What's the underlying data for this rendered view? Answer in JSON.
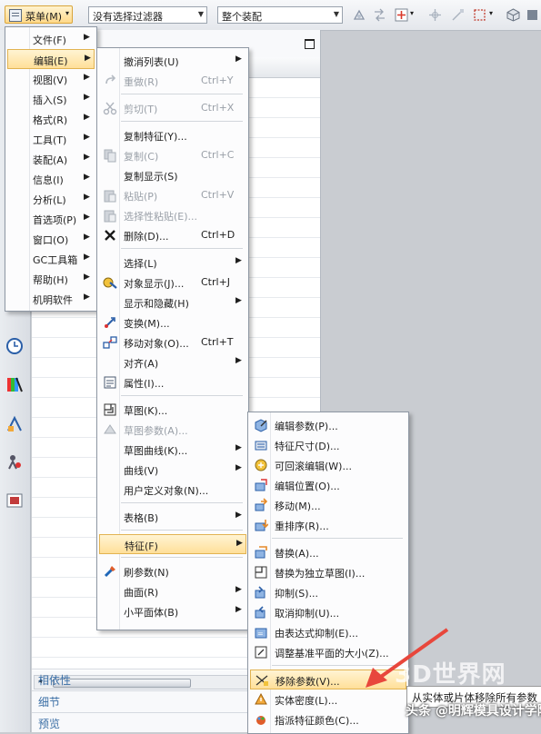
{
  "toolbar": {
    "menu_label": "菜单(M)",
    "filter_value": "没有选择过滤器",
    "scope_value": "整个装配"
  },
  "main_menu": [
    {
      "label": "文件(F)",
      "sub": true
    },
    {
      "label": "编辑(E)",
      "sub": true,
      "active": true
    },
    {
      "label": "视图(V)",
      "sub": true
    },
    {
      "label": "插入(S)",
      "sub": true
    },
    {
      "label": "格式(R)",
      "sub": true
    },
    {
      "label": "工具(T)",
      "sub": true
    },
    {
      "label": "装配(A)",
      "sub": true
    },
    {
      "label": "信息(I)",
      "sub": true
    },
    {
      "label": "分析(L)",
      "sub": true
    },
    {
      "label": "首选项(P)",
      "sub": true
    },
    {
      "label": "窗口(O)",
      "sub": true
    },
    {
      "label": "GC工具箱",
      "sub": true
    },
    {
      "label": "帮助(H)",
      "sub": true
    },
    {
      "label": "机明软件",
      "sub": true
    }
  ],
  "edit_menu": [
    {
      "label": "撤消列表(U)",
      "sub": true,
      "icon": ""
    },
    {
      "label": "重做(R)",
      "shortcut": "Ctrl+Y",
      "disabled": true,
      "icon": "redo-icon"
    },
    {
      "sep": true
    },
    {
      "label": "剪切(T)",
      "shortcut": "Ctrl+X",
      "disabled": true,
      "icon": "scissors-icon"
    },
    {
      "sep": true
    },
    {
      "label": "复制特征(Y)...",
      "icon": ""
    },
    {
      "label": "复制(C)",
      "shortcut": "Ctrl+C",
      "disabled": true,
      "icon": "copy-icon"
    },
    {
      "label": "复制显示(S)",
      "icon": ""
    },
    {
      "label": "粘贴(P)",
      "shortcut": "Ctrl+V",
      "disabled": true,
      "icon": "paste-icon"
    },
    {
      "label": "选择性粘贴(E)...",
      "disabled": true,
      "icon": "paste-special-icon"
    },
    {
      "label": "删除(D)...",
      "shortcut": "Ctrl+D",
      "icon": "delete-icon"
    },
    {
      "sep": true
    },
    {
      "label": "选择(L)",
      "sub": true,
      "icon": ""
    },
    {
      "label": "对象显示(J)...",
      "shortcut": "Ctrl+J",
      "icon": "object-display-icon"
    },
    {
      "label": "显示和隐藏(H)",
      "sub": true,
      "icon": ""
    },
    {
      "label": "变换(M)...",
      "icon": "transform-icon"
    },
    {
      "label": "移动对象(O)...",
      "shortcut": "Ctrl+T",
      "icon": "move-object-icon"
    },
    {
      "label": "对齐(A)",
      "sub": true,
      "icon": ""
    },
    {
      "label": "属性(I)...",
      "icon": "properties-icon"
    },
    {
      "sep": true
    },
    {
      "label": "草图(K)...",
      "icon": "sketch-icon"
    },
    {
      "label": "草图参数(A)...",
      "disabled": true,
      "icon": "sketch-params-icon"
    },
    {
      "label": "草图曲线(K)...",
      "sub": true,
      "icon": ""
    },
    {
      "label": "曲线(V)",
      "sub": true,
      "icon": ""
    },
    {
      "label": "用户定义对象(N)...",
      "icon": ""
    },
    {
      "sep": true
    },
    {
      "label": "表格(B)",
      "sub": true,
      "icon": ""
    },
    {
      "sep": true
    },
    {
      "label": "特征(F)",
      "sub": true,
      "highlight": true,
      "icon": ""
    },
    {
      "sep": true
    },
    {
      "label": "刷参数(N)",
      "icon": "brush-params-icon"
    },
    {
      "label": "曲面(R)",
      "sub": true,
      "icon": ""
    },
    {
      "label": "小平面体(B)",
      "sub": true,
      "icon": ""
    }
  ],
  "feature_menu": [
    {
      "label": "编辑参数(P)...",
      "icon": "edit-params-icon"
    },
    {
      "label": "特征尺寸(D)...",
      "icon": "feature-dimension-icon"
    },
    {
      "label": "可回滚编辑(W)...",
      "icon": "rollback-edit-icon"
    },
    {
      "label": "编辑位置(O)...",
      "icon": "edit-position-icon"
    },
    {
      "label": "移动(M)...",
      "icon": "move-feature-icon"
    },
    {
      "label": "重排序(R)...",
      "icon": "reorder-icon"
    },
    {
      "sep": true
    },
    {
      "label": "替换(A)...",
      "icon": "replace-icon"
    },
    {
      "label": "替换为独立草图(I)...",
      "icon": "replace-sketch-icon"
    },
    {
      "label": "抑制(S)...",
      "icon": "suppress-icon"
    },
    {
      "label": "取消抑制(U)...",
      "icon": "unsuppress-icon"
    },
    {
      "label": "由表达式抑制(E)...",
      "icon": "expression-suppress-icon"
    },
    {
      "label": "调整基准平面的大小(Z)...",
      "icon": "resize-plane-icon"
    },
    {
      "sep": true
    },
    {
      "label": "移除参数(V)...",
      "highlight": true,
      "icon": "remove-params-icon"
    },
    {
      "label": "实体密度(L)...",
      "icon": "density-icon"
    },
    {
      "label": "指派特征颜色(C)...",
      "icon": "assign-color-icon"
    }
  ],
  "panel": {
    "sections": [
      "相依性",
      "细节",
      "预览"
    ]
  },
  "tooltip": "从实体或片体移除所有参数",
  "watermark": {
    "logo": "3D世界网",
    "credit": "头条 @明辉模具设计学院"
  },
  "colors": {
    "highlight": "#ffdf99",
    "link": "#3a6ea5",
    "arrow": "#e8473c"
  }
}
